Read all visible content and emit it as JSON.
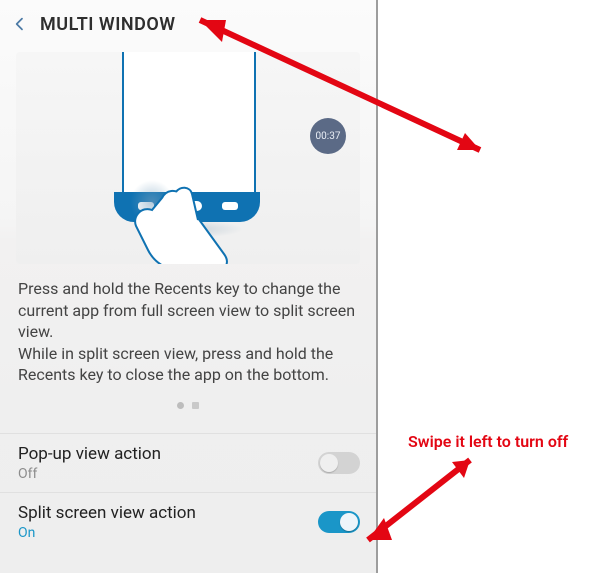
{
  "header": {
    "title": "MULTI WINDOW"
  },
  "illustration": {
    "badge": "00:37"
  },
  "description": {
    "p1": "Press and hold the Recents key to change the current app from full screen view to split screen view.",
    "p2": "While in split screen view, press and hold the Recents key to close the app on the bottom."
  },
  "rows": {
    "popup": {
      "label": "Pop-up view action",
      "state": "Off",
      "on": false
    },
    "split": {
      "label": "Split screen view action",
      "state": "On",
      "on": true
    }
  },
  "annotation": {
    "swipe": "Swipe it left to turn off"
  }
}
